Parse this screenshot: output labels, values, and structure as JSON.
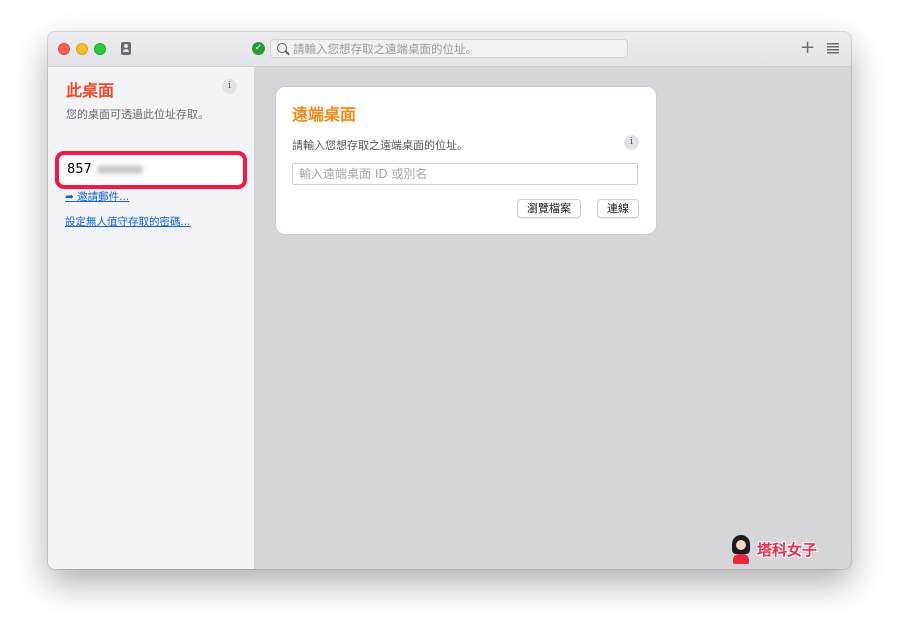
{
  "toolbar": {
    "search_placeholder": "請輸入您想存取之遠端桌面的位址。",
    "add_label": "+"
  },
  "sidebar": {
    "title": "此桌面",
    "info_label": "i",
    "description": "您的桌面可透過此位址存取。",
    "desk_id": "857",
    "invite_link": "➦ 邀請郵件...",
    "password_link": "設定無人值守存取的密碼..."
  },
  "main": {
    "card_title": "遠端桌面",
    "card_description": "請輸入您想存取之遠端桌面的位址。",
    "info_label": "i",
    "input_placeholder": "輸入遠端桌面 ID 或別名",
    "browse_button": "瀏覽檔案",
    "connect_button": "連線"
  },
  "watermark": {
    "text": "塔科女子"
  },
  "colors": {
    "sidebar_title": "#f04a2c",
    "card_title": "#f28a1c",
    "highlight_border": "#f61946",
    "link": "#0e62d8"
  },
  "icons": [
    "address-book-icon",
    "secure-check-icon",
    "search-icon",
    "plus-icon",
    "menu-icon",
    "info-icon"
  ]
}
